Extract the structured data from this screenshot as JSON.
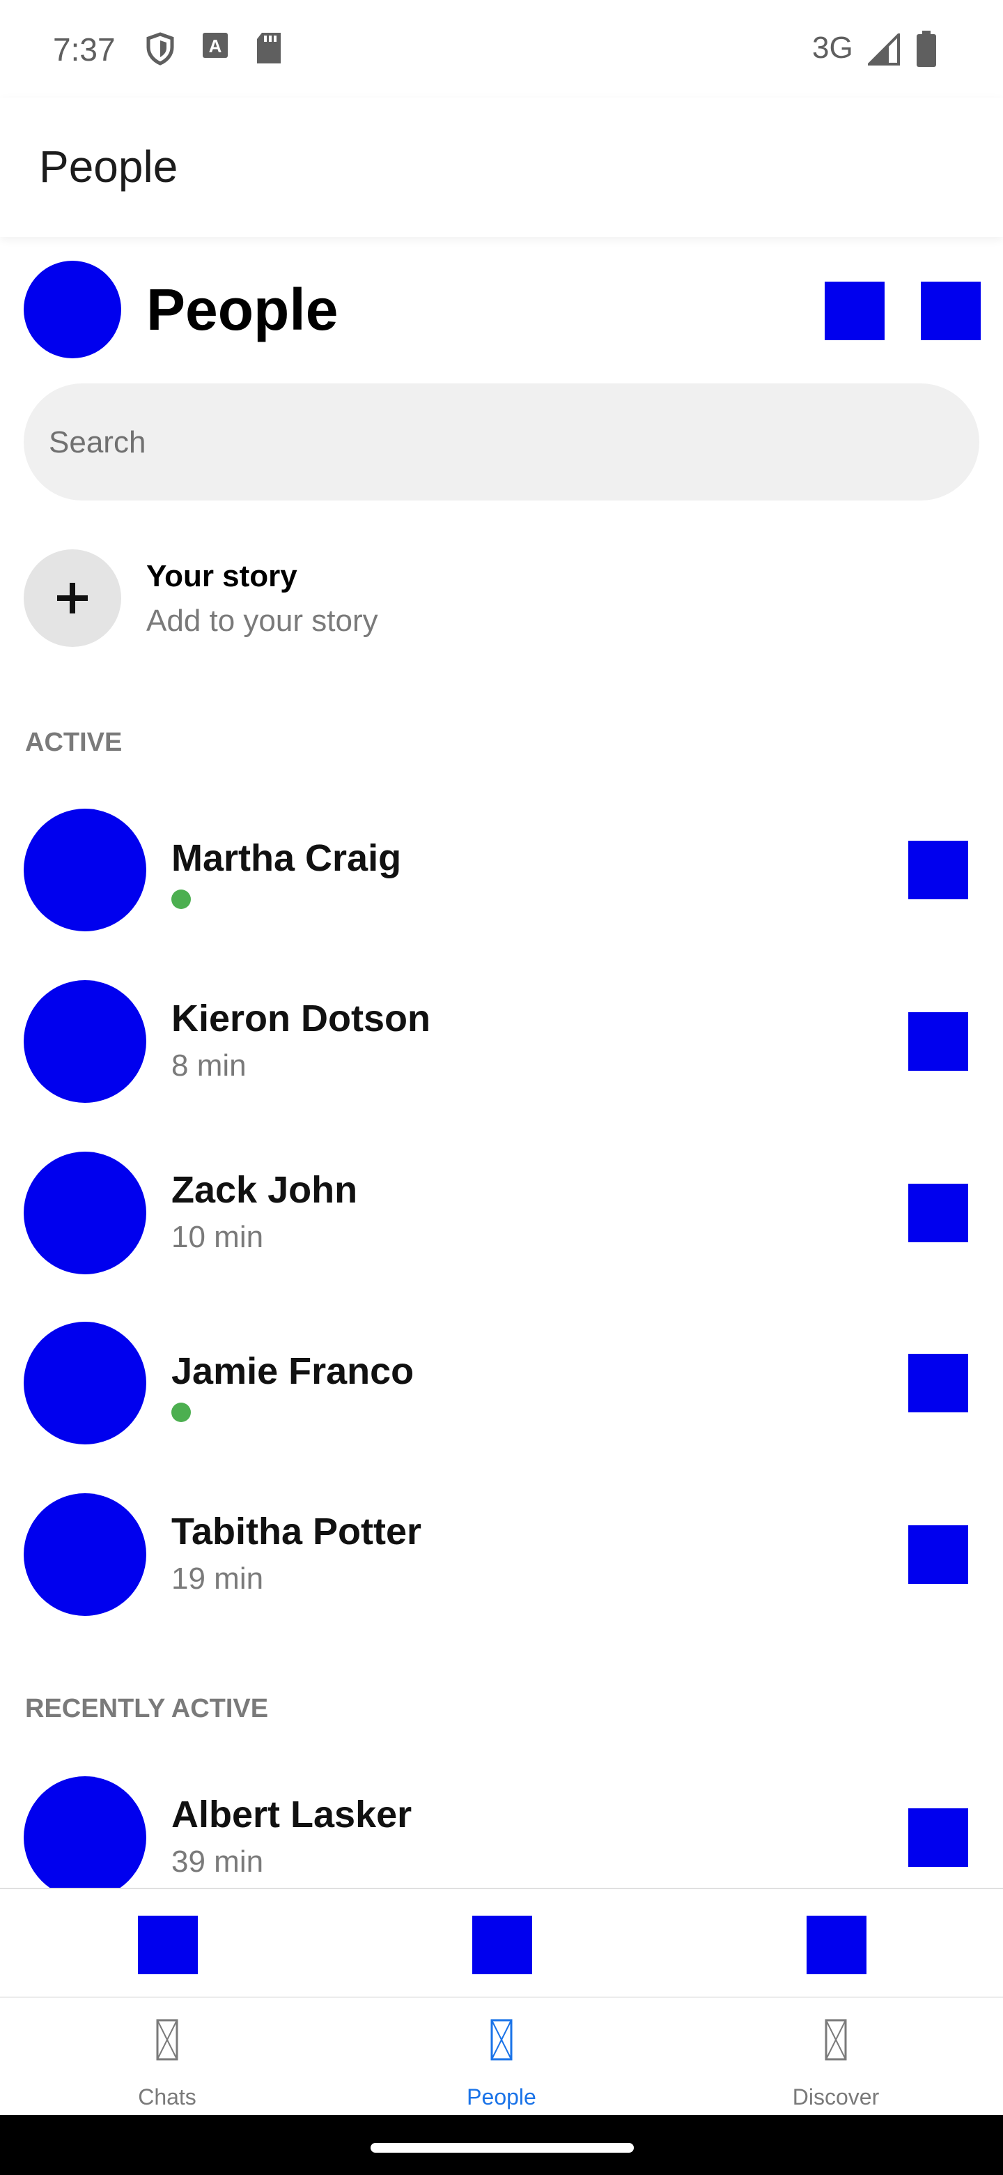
{
  "status_bar": {
    "time": "7:37",
    "network": "3G",
    "icons": [
      "shield-icon",
      "a-box-icon",
      "sd-card-icon",
      "signal-icon",
      "battery-icon"
    ]
  },
  "app_bar": {
    "title": "People"
  },
  "header": {
    "title": "People",
    "buttons": [
      "header-action-1",
      "header-action-2"
    ],
    "accent_color": "#0000ee"
  },
  "search": {
    "placeholder": "Search"
  },
  "story": {
    "title": "Your story",
    "subtitle": "Add to your story",
    "icon": "plus-icon"
  },
  "sections": {
    "active": "ACTIVE",
    "recently_active": "RECENTLY ACTIVE"
  },
  "active_people": [
    {
      "name": "Martha Craig",
      "status": "",
      "online": true
    },
    {
      "name": "Kieron Dotson",
      "status": "8 min",
      "online": false
    },
    {
      "name": "Zack John",
      "status": "10 min",
      "online": false
    },
    {
      "name": "Jamie Franco",
      "status": "",
      "online": true
    },
    {
      "name": "Tabitha Potter",
      "status": "19 min",
      "online": false
    }
  ],
  "recent_people": [
    {
      "name": "Albert Lasker",
      "status": "39 min",
      "online": false
    }
  ],
  "bottom_nav": {
    "items": [
      {
        "label": "Chats",
        "icon": "chats-icon",
        "active": false
      },
      {
        "label": "People",
        "icon": "people-icon",
        "active": true
      },
      {
        "label": "Discover",
        "icon": "discover-icon",
        "active": false
      }
    ],
    "active_color": "#1a73e8",
    "online_color": "#4caf50"
  }
}
